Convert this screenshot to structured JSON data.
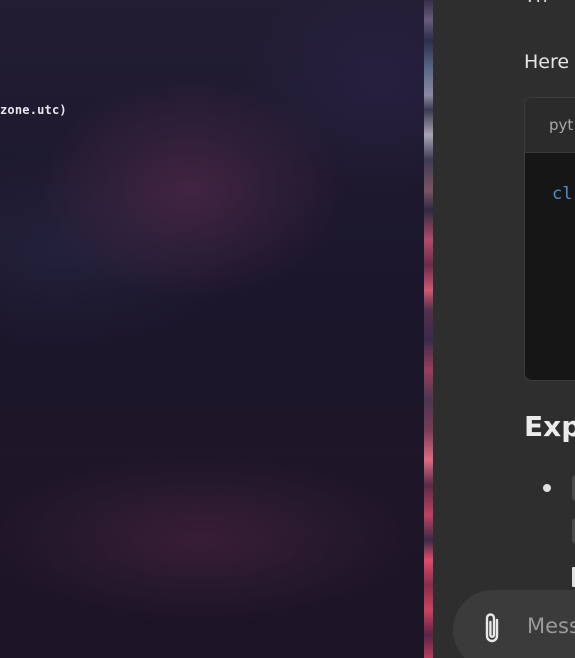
{
  "terminal": {
    "line_fragment": "zone.utc)"
  },
  "chat": {
    "top_text": "Th",
    "intro_text": "Here",
    "code_block": {
      "language_label": "pyt",
      "keyword": "cl"
    },
    "explanation_heading": "Exp",
    "composer": {
      "attach_icon": "paperclip-icon",
      "placeholder": "Mess"
    }
  }
}
